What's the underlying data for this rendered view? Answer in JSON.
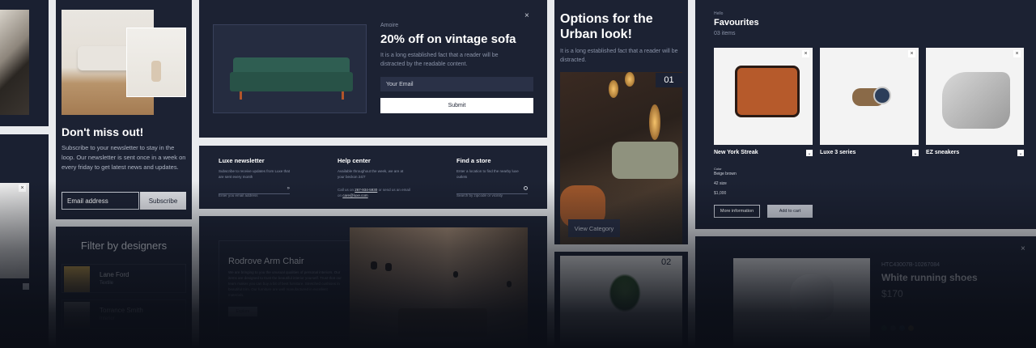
{
  "newsletter_card": {
    "title": "Don't miss out!",
    "body": "Subscribe to your newsletter to stay in the loop. Our newsletter is sent once in a week on every friday to get latest news and updates.",
    "email_placeholder": "Email address",
    "subscribe_label": "Subscribe"
  },
  "filter_card": {
    "title": "Filter by designers",
    "designers": [
      {
        "name": "Lane Ford",
        "role": "Textile"
      },
      {
        "name": "Torrance Smith",
        "role": "Interior"
      }
    ]
  },
  "sofa_popup": {
    "brand": "Amoire",
    "title": "20% off on vintage sofa",
    "body": "It is a long established fact that a reader will be distracted by the readable content.",
    "email_placeholder": "Your Email",
    "submit_label": "Submit",
    "close": "×"
  },
  "footer_bar": {
    "newsletter_title": "Luxe newsletter",
    "newsletter_text": "Subscribe to receive updates from Luxe that are sent every month",
    "newsletter_placeholder": "Enter you email address",
    "help_title": "Help center",
    "help_text": "Available throughout the week, we are at your beckon 24/7",
    "help_contact_prefix": "Call us on",
    "help_phone": "267-934-5930",
    "help_contact_mid": "or send us an email on",
    "help_email": "care@luxe.com",
    "store_title": "Find a store",
    "store_text": "Enter a location to find the nearby luxe outlets",
    "store_placeholder": "Search by zipcode or vicinity"
  },
  "arm_chair": {
    "title": "Rodrove Arm Chair",
    "body": "We are bringing to you the unusual qualities of personal interiors. Our items are designed to trust the beautiful interior yourself. Trust that our team makes you can buy a bit of best furniture. Stretched cushions in beautiful trim. Our furniture are well manufactured in excellent materials.",
    "button": "Explore"
  },
  "urban_card": {
    "title": "Options for the Urban look!",
    "body": "It is a long established fact that a reader will be distracted.",
    "items": [
      {
        "num": "01",
        "button": "View Category"
      },
      {
        "num": "02"
      }
    ]
  },
  "favourites": {
    "eyebrow": "Hello",
    "title": "Favourites",
    "count": "03 items",
    "products": [
      {
        "name": "New York Streak"
      },
      {
        "name": "Luxe 3 series"
      },
      {
        "name": "EZ sneakers"
      }
    ],
    "details": {
      "label": "Color",
      "color": "Beige brown",
      "size": "42 size",
      "price": "$1,000"
    },
    "more_info": "More information",
    "add_to_cart": "Add to cart"
  },
  "shoe_card": {
    "sku": "HTC43007B-10267084",
    "title": "White running shoes",
    "price": "$170",
    "swatches": [
      "#2f6b4f",
      "#4a5368",
      "#2f5a8a",
      "#b89a3a"
    ]
  },
  "colors": {
    "navy": "#1c2233",
    "accent_input": "#2a3147"
  }
}
